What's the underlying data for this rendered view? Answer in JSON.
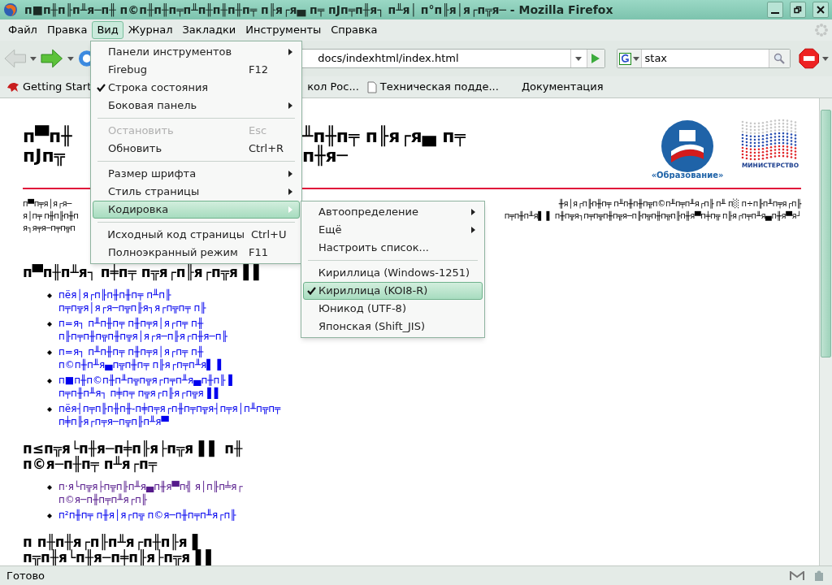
{
  "window": {
    "title": "п■п╫п╟п╨я─п╫ п©п╫п╫п╤п╨п╫п╫п╫п╤ п╟я┌я▄ п╤ пЈп╤п╫я┐ п╨я│ п°п╟я│я┌п╦я─ - Mozilla Firefox"
  },
  "menubar": [
    {
      "label": "Файл",
      "selected": false
    },
    {
      "label": "Правка",
      "selected": false
    },
    {
      "label": "Вид",
      "selected": true
    },
    {
      "label": "Журнал",
      "selected": false
    },
    {
      "label": "Закладки",
      "selected": false
    },
    {
      "label": "Инструменты",
      "selected": false
    },
    {
      "label": "Справка",
      "selected": false
    }
  ],
  "toolbar": {
    "url": "docs/indexhtml/index.html",
    "search": "stax"
  },
  "bookmarks": [
    {
      "label": "Getting Start",
      "kind": "feed"
    },
    {
      "label": "кол Рос...",
      "kind": "plain"
    },
    {
      "label": "Техническая подде...",
      "kind": "page"
    },
    {
      "label": "Документация",
      "kind": "plain"
    }
  ],
  "view_menu": [
    {
      "kind": "item",
      "label": "Панели инструментов",
      "submenu": true,
      "checked": false,
      "disabled": false,
      "selected": false
    },
    {
      "kind": "item",
      "label": "Firebug",
      "shortcut": "F12",
      "submenu": false,
      "checked": false,
      "disabled": false,
      "selected": false
    },
    {
      "kind": "item",
      "label": "Строка состояния",
      "submenu": false,
      "checked": true,
      "disabled": false,
      "selected": false
    },
    {
      "kind": "item",
      "label": "Боковая панель",
      "submenu": true,
      "checked": false,
      "disabled": false,
      "selected": false
    },
    {
      "kind": "separator"
    },
    {
      "kind": "item",
      "label": "Остановить",
      "shortcut": "Esc",
      "submenu": false,
      "checked": false,
      "disabled": true,
      "selected": false
    },
    {
      "kind": "item",
      "label": "Обновить",
      "shortcut": "Ctrl+R",
      "submenu": false,
      "checked": false,
      "disabled": false,
      "selected": false
    },
    {
      "kind": "separator"
    },
    {
      "kind": "item",
      "label": "Размер шрифта",
      "submenu": true,
      "checked": false,
      "disabled": false,
      "selected": false
    },
    {
      "kind": "item",
      "label": "Стиль страницы",
      "submenu": true,
      "checked": false,
      "disabled": false,
      "selected": false
    },
    {
      "kind": "item",
      "label": "Кодировка",
      "submenu": true,
      "checked": false,
      "disabled": false,
      "selected": true
    },
    {
      "kind": "separator"
    },
    {
      "kind": "item",
      "label": "Исходный код страницы",
      "shortcut": "Ctrl+U",
      "submenu": false,
      "checked": false,
      "disabled": false,
      "selected": false
    },
    {
      "kind": "item",
      "label": "Полноэкранный режим",
      "shortcut": "F11",
      "submenu": false,
      "checked": false,
      "disabled": false,
      "selected": false
    }
  ],
  "encoding_menu": [
    {
      "kind": "item",
      "label": "Автоопределение",
      "submenu": true,
      "checked": false,
      "selected": false
    },
    {
      "kind": "item",
      "label": "Ещё",
      "submenu": true,
      "checked": false,
      "selected": false
    },
    {
      "kind": "item",
      "label": "Настроить список...",
      "submenu": false,
      "checked": false,
      "selected": false
    },
    {
      "kind": "separator"
    },
    {
      "kind": "item",
      "label": "Кириллица (Windows-1251)",
      "submenu": false,
      "checked": false,
      "selected": false
    },
    {
      "kind": "item",
      "label": "Кириллица (KOI8-R)",
      "submenu": false,
      "checked": true,
      "selected": true
    },
    {
      "kind": "item",
      "label": "Юникод (UTF-8)",
      "submenu": false,
      "checked": false,
      "selected": false
    },
    {
      "kind": "item",
      "label": "Японская (Shift_JIS)",
      "submenu": false,
      "checked": false,
      "selected": false
    }
  ],
  "page": {
    "heading_left": [
      "п▀п╫",
      "пЈп╦"
    ],
    "heading_right": [
      "╨п╫п╤ п╟я┌я▄ п╤",
      "п╫я─"
    ],
    "logos": {
      "edu": "«Образование»",
      "ministry": "МИНИСТЕРСТВО"
    },
    "intro_left": [
      "п▀п╤я│я┌я─",
      "я│п╤ п╫п╟п╫п",
      "я┐я╤я─п╤п╦п"
    ],
    "intro_right": [
      "╫я│я┌п╟п╫п╤   п╨п╫п╫п╦п©п╨п╤п╨я┌п╟ п╨   п░   п÷п╟п╨п╤я┌п╟",
      "п╤п╫п╨я▌ ▌   п╫п╦я┐п╤п╦п╫п╦я─п╟п╦п╫п╦п╟п╫я▀п╪п╦ п╟я┌п╤п╨я▄п╫я▀я┘"
    ],
    "sections": [
      {
        "heading": [
          "п▀п╫п╨я┐ п╪п╤ п╦я┌п╟я┌п╦я▐ ▌"
        ],
        "links": [
          {
            "lines": [
              "пёя│я┌п╟п╫п╫п╤ п╨п╟",
              "п╤п╦я│я┌я─п╦п╟я┐я┌п╦п╤ п╟"
            ],
            "visited": false
          },
          {
            "lines": [
              "п=я┐ п╨п╫п╤ п╫п╤я│я┌п╤ п╫",
              "п╟п╤п╫п╦п╫п╦я│я┌я─п╟я┌п╫я─п╟"
            ],
            "visited": false
          },
          {
            "lines": [
              "п=я┐ п╨п╫п╤ п╫п╤я│я┌п╤ п╫",
              "п©п╫п╨я▄п╦п╫п╤ п╟я┌п╤п╨я▌ ▌"
            ],
            "visited": false
          },
          {
            "lines": [
              "п■п╫п©п╫п╨п╦п╦я┌п╤п╨я▄п╫п╟ ▌",
              "п╤п╫п╨я┐ п╪п╤ п╦я┌п╟я┌п╦я▐ ▌"
            ],
            "visited": false
          },
          {
            "lines": [
              "пёя┤п╤п╟п╫п╫-п╪п╤я┌п╫п╤п╦я┤п╤я│п╨п╦п╤",
              "п╪п╟я┌п╤я─п╦п╟п╨я▀"
            ],
            "visited": false
          }
        ]
      },
      {
        "heading": [
          "п≤п╦я└п╫я─п╪п╟я├п╦я▐ ▌ п╫",
          "п©я─п╫п╤ п╨я┌п╤"
        ],
        "links": [
          {
            "lines": [
              "п·я└п╦я├п╦п╟п╨я▄п╫я▀п╣ я│п╟п╧я┌",
              "п©я─п╫п╤п╨я┌п╟"
            ],
            "visited": true
          },
          {
            "lines": [
              "п²п╫п╤ п╫я│я┌п╦ п©я─п╫п╤п╨я┌п╟"
            ],
            "visited": false
          }
        ]
      },
      {
        "heading": [
          "п п╫п╫я┌п╟п╨я┌п╫п╟я ▌",
          "п╦п╫я└п╫я─п╪п╟я├п╦я▐ ▌"
        ]
      }
    ]
  },
  "status_bar": {
    "text": "Готово"
  }
}
